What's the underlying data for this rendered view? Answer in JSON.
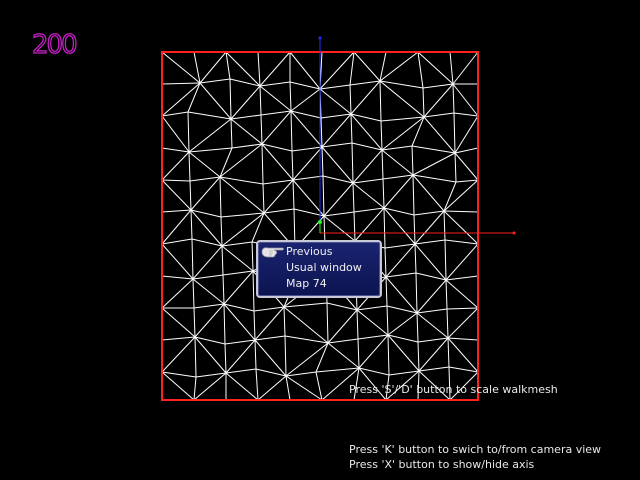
{
  "counter": "200",
  "menu": {
    "items": [
      "Previous",
      "Usual window",
      "Map 74"
    ],
    "selected_index": 0
  },
  "hints": {
    "scale": "Press 'S'/'D' button to scale walkmesh",
    "camera": "Press 'K' button to swich to/from camera view",
    "axis": "Press 'X' button to show/hide axis"
  },
  "colors": {
    "background": "#000000",
    "mesh_lines": "#ffffff",
    "boundary": "#ff2020",
    "axis_x": "#ff2020",
    "axis_y": "#2030ff",
    "axis_z": "#20ff20",
    "counter": "#d020d0",
    "menu_bg": "#141c60"
  }
}
